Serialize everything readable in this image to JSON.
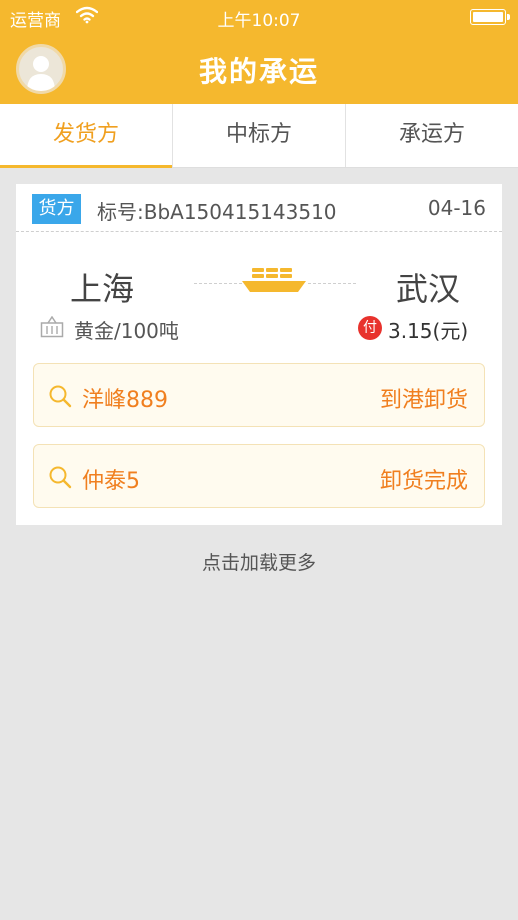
{
  "status_bar": {
    "carrier": "运营商",
    "time": "上午10:07"
  },
  "header": {
    "title": "我的承运"
  },
  "tabs": [
    {
      "label": "发货方",
      "active": true
    },
    {
      "label": "中标方",
      "active": false
    },
    {
      "label": "承运方",
      "active": false
    }
  ],
  "card": {
    "badge": "货方",
    "bid_number": "标号:BbA150415143510",
    "date": "04-16",
    "origin": "上海",
    "destination": "武汉",
    "cargo": "黄金/100吨",
    "pay_label": "付",
    "price": "3.15(元)",
    "ships": [
      {
        "name": "洋峰889",
        "status": "到港卸货"
      },
      {
        "name": "仲泰5",
        "status": "卸货完成"
      }
    ]
  },
  "load_more": "点击加载更多",
  "colors": {
    "brand": "#f5b82e",
    "badge": "#3aa7ea",
    "accent_orange": "#f07f1f",
    "pay_red": "#e8322d"
  },
  "icons": {
    "wifi": "wifi-icon",
    "battery": "battery-icon",
    "avatar": "avatar",
    "ship": "ship-icon",
    "cargo": "cargo-box-icon",
    "search": "search-icon"
  }
}
